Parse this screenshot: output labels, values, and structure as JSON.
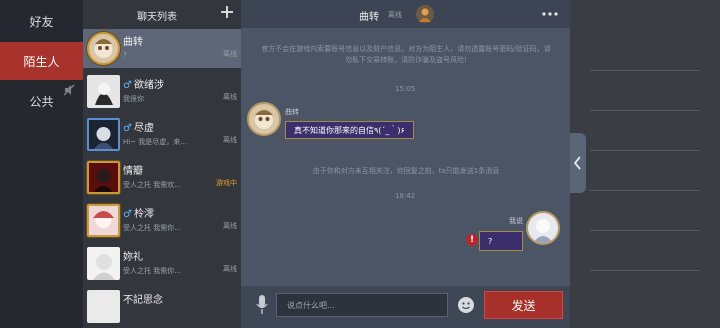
{
  "tabs": [
    {
      "label": "好友",
      "active": false
    },
    {
      "label": "陌生人",
      "active": true
    },
    {
      "label": "公共",
      "active": false
    }
  ],
  "chat_list": {
    "title": "聊天列表",
    "items": [
      {
        "name": "曲转",
        "preview": "?",
        "status": "离线",
        "selected": true,
        "gender": ""
      },
      {
        "name": "欲绪涉",
        "preview": "我很你",
        "status": "离线",
        "selected": false,
        "gender": "male"
      },
      {
        "name": "尽虚",
        "preview": "Hi~ 我是尽虚，来...",
        "status": "离线",
        "selected": false,
        "gender": "male"
      },
      {
        "name": "情瓣",
        "preview": "受人之托 我需欢...",
        "status": "游戏中",
        "selected": false,
        "gender": ""
      },
      {
        "name": "柃澪",
        "preview": "受人之托 我需你...",
        "status": "离线",
        "selected": false,
        "gender": "male"
      },
      {
        "name": "妳礼",
        "preview": "受人之托 我需你...",
        "status": "离线",
        "selected": false,
        "gender": ""
      },
      {
        "name": "不記思念",
        "preview": "",
        "status": "",
        "selected": false,
        "gender": ""
      }
    ]
  },
  "chat": {
    "name": "曲转",
    "status": "离线",
    "notice": "官方不会在游戏内索要账号信息以及财产信息，对方为陌生人，请勿透露账号密码/验证码，请勿私下交易转账，请防诈骗及盗号风险!",
    "time1": "15:05",
    "incoming_sender": "曲转",
    "incoming_text": "真不知道你那来的自信٩(´_｀)۶",
    "system_note": "由于你和对方未互相关注，你回复之前，ta只能发送1条消息",
    "time2": "18:42",
    "outgoing_sender": "我说",
    "outgoing_text": "?",
    "error_mark": "!",
    "input_placeholder": "说点什么吧...",
    "send_label": "发送"
  },
  "colors": {
    "accent_red": "#a8302b",
    "active_tab": "#a8332c",
    "playing_status": "#e0a22a",
    "male_icon": "#5fb4ff"
  }
}
